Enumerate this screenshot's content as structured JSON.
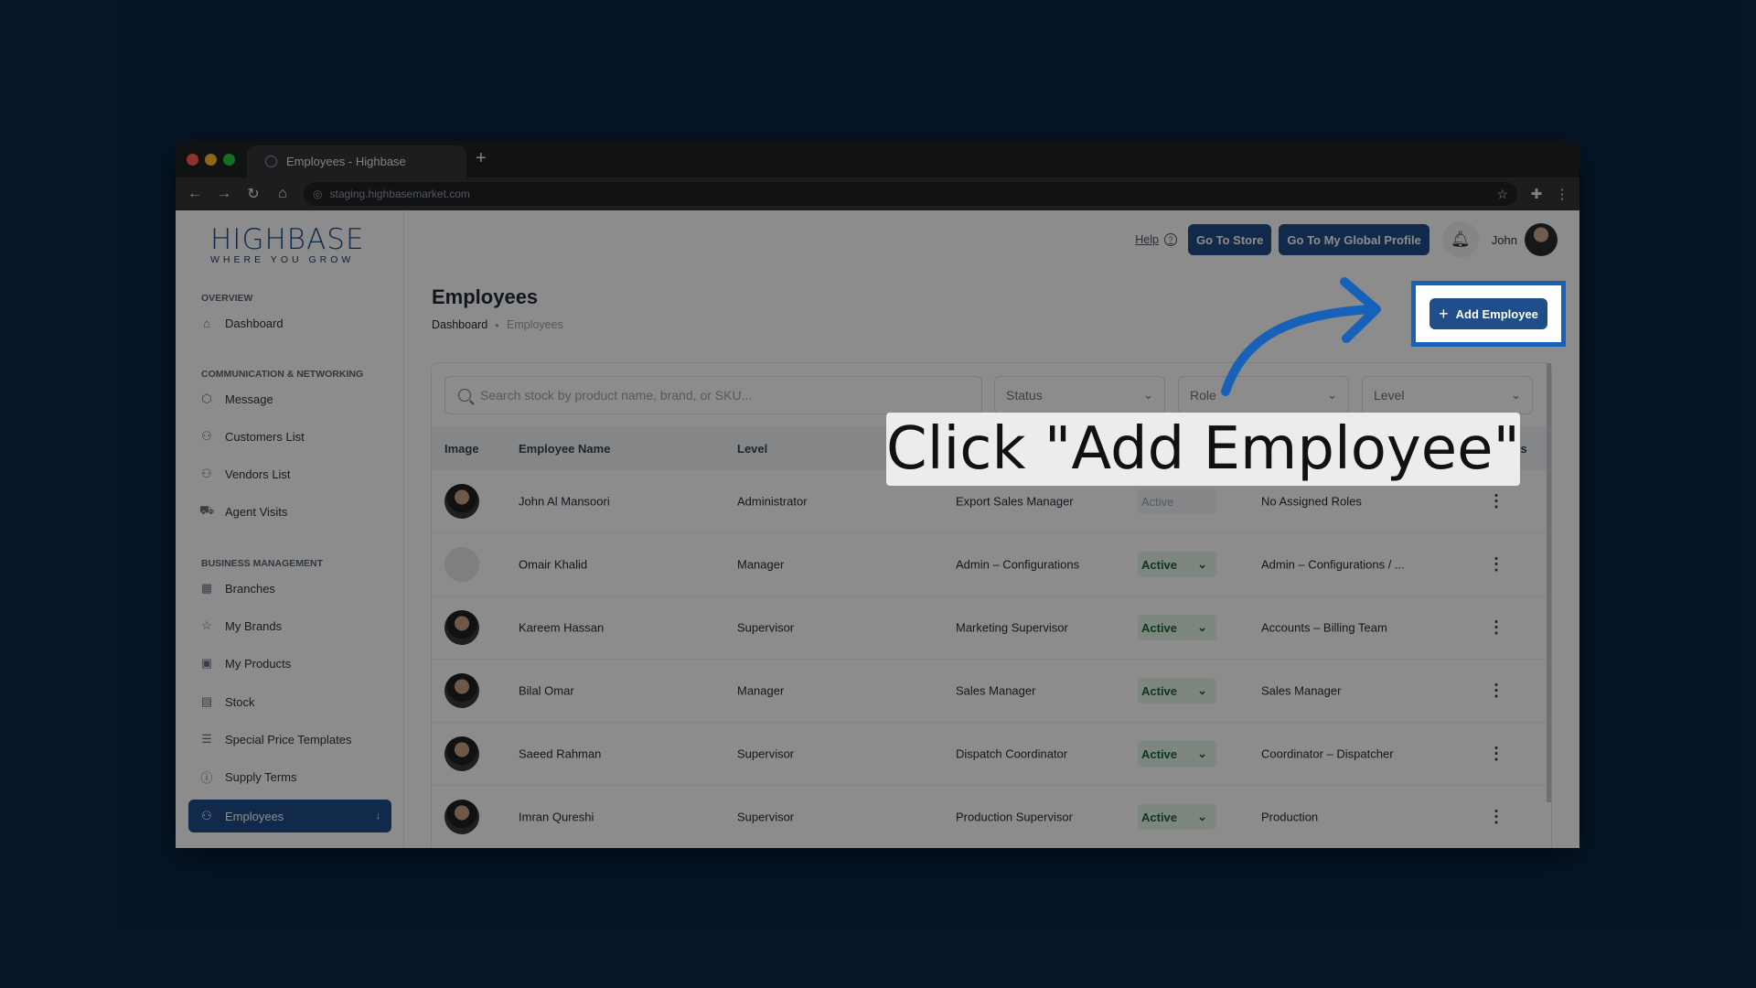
{
  "browser": {
    "tab_title": "Employees - Highbase",
    "url": "staging.highbasemarket.com"
  },
  "logo": {
    "brand": "HIGHBASE",
    "tagline": "WHERE YOU GROW"
  },
  "sidebar": {
    "sections": [
      {
        "label": "OVERVIEW"
      },
      {
        "label": "COMMUNICATION & NETWORKING"
      },
      {
        "label": "BUSINESS MANAGEMENT"
      }
    ],
    "items": [
      {
        "label": "Dashboard",
        "icon": "home-icon"
      },
      {
        "label": "Message",
        "icon": "cube-icon"
      },
      {
        "label": "Customers List",
        "icon": "users-icon"
      },
      {
        "label": "Vendors List",
        "icon": "users-icon"
      },
      {
        "label": "Agent Visits",
        "icon": "truck-icon"
      },
      {
        "label": "Branches",
        "icon": "store-icon"
      },
      {
        "label": "My Brands",
        "icon": "star-icon"
      },
      {
        "label": "My Products",
        "icon": "box-icon"
      },
      {
        "label": "Stock",
        "icon": "archive-icon"
      },
      {
        "label": "Special Price Templates",
        "icon": "list-icon"
      },
      {
        "label": "Supply Terms",
        "icon": "info-icon"
      },
      {
        "label": "Employees",
        "icon": "team-icon",
        "active": true
      }
    ]
  },
  "header": {
    "help": "Help",
    "go_to_store": "Go To Store",
    "global_profile": "Go To My Global Profile",
    "user_name": "John"
  },
  "page": {
    "title": "Employees",
    "breadcrumb": [
      "Dashboard",
      "Employees"
    ],
    "add_button": "Add Employee"
  },
  "filters": {
    "search_placeholder": "Search stock by product name, brand, or SKU...",
    "status": "Status",
    "role": "Role",
    "level": "Level"
  },
  "table": {
    "columns": [
      "Image",
      "Employee Name",
      "Level",
      "Actions"
    ],
    "rows": [
      {
        "name": "John Al Mansoori",
        "level": "Administrator",
        "position": "Export Sales Manager",
        "status": "Active",
        "roles": "No Assigned Roles"
      },
      {
        "name": "Omair Khalid",
        "level": "Manager",
        "position": "Admin – Configurations",
        "status": "Active",
        "roles": "Admin – Configurations / ..."
      },
      {
        "name": "Kareem Hassan",
        "level": "Supervisor",
        "position": "Marketing Supervisor",
        "status": "Active",
        "roles": "Accounts – Billing Team"
      },
      {
        "name": "Bilal Omar",
        "level": "Manager",
        "position": "Sales Manager",
        "status": "Active",
        "roles": "Sales Manager"
      },
      {
        "name": "Saeed Rahman",
        "level": "Supervisor",
        "position": "Dispatch Coordinator",
        "status": "Active",
        "roles": "Coordinator – Dispatcher"
      },
      {
        "name": "Imran Qureshi",
        "level": "Supervisor",
        "position": "Production Supervisor",
        "status": "Active",
        "roles": "Production"
      }
    ]
  },
  "tutorial": {
    "caption": "Click \"Add Employee\""
  },
  "colors": {
    "background": "#0b2647",
    "primary": "#1f4e8a",
    "highlight": "#1762b8",
    "active_status": "#166534"
  }
}
